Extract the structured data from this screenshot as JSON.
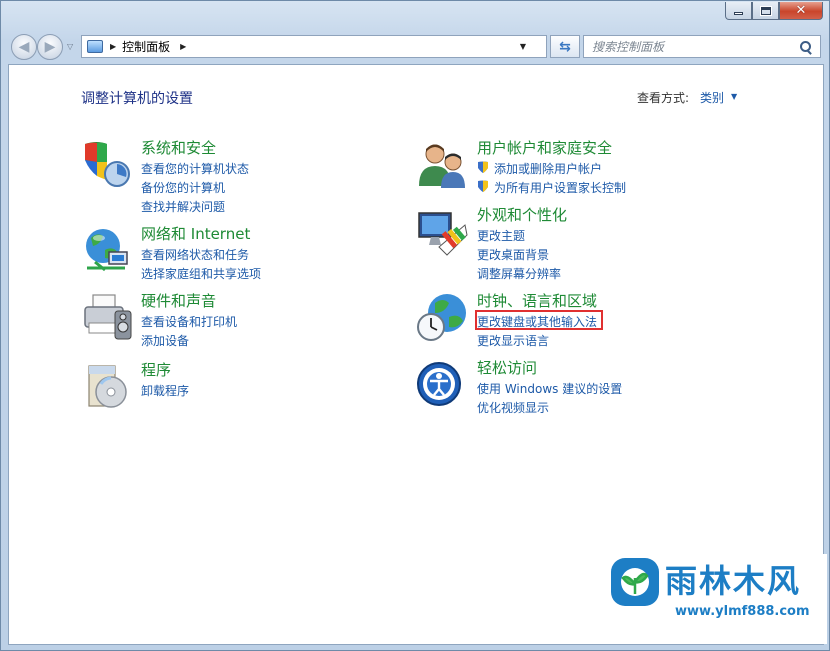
{
  "window": {
    "caption": {
      "minimize": "—",
      "maximize": "□",
      "close": "✕"
    }
  },
  "nav": {
    "back": "◀",
    "forward": "▶",
    "address": {
      "path_label": "控制面板"
    },
    "search": {
      "placeholder": "搜索控制面板"
    }
  },
  "header": {
    "title": "调整计算机的设置",
    "view_by_label": "查看方式:",
    "view_by_value": "类别"
  },
  "categories": [
    {
      "icon": "shield-flag-icon",
      "title": "系统和安全",
      "links": [
        "查看您的计算机状态",
        "备份您的计算机",
        "查找并解决问题"
      ]
    },
    {
      "icon": "network-globe-icon",
      "title": "网络和 Internet",
      "links": [
        "查看网络状态和任务",
        "选择家庭组和共享选项"
      ]
    },
    {
      "icon": "printer-icon",
      "title": "硬件和声音",
      "links": [
        "查看设备和打印机",
        "添加设备"
      ]
    },
    {
      "icon": "programs-disc-icon",
      "title": "程序",
      "links": [
        "卸载程序"
      ]
    },
    {
      "icon": "users-icon",
      "title": "用户帐户和家庭安全",
      "links": [
        "添加或删除用户帐户",
        "为所有用户设置家长控制"
      ]
    },
    {
      "icon": "monitor-palette-icon",
      "title": "外观和个性化",
      "links": [
        "更改主题",
        "更改桌面背景",
        "调整屏幕分辨率"
      ]
    },
    {
      "icon": "globe-clock-icon",
      "title": "时钟、语言和区域",
      "links": [
        "更改键盘或其他输入法",
        "更改显示语言"
      ]
    },
    {
      "icon": "ease-of-access-icon",
      "title": "轻松访问",
      "links": [
        "使用 Windows 建议的设置",
        "优化视频显示"
      ]
    }
  ],
  "watermark": {
    "title": "雨林木风",
    "url": "www.ylmf888.com"
  },
  "colors": {
    "category_title": "#1e8a35",
    "link": "#1e5aa8",
    "highlight": "#e03030",
    "watermark": "#1d7ec5"
  }
}
